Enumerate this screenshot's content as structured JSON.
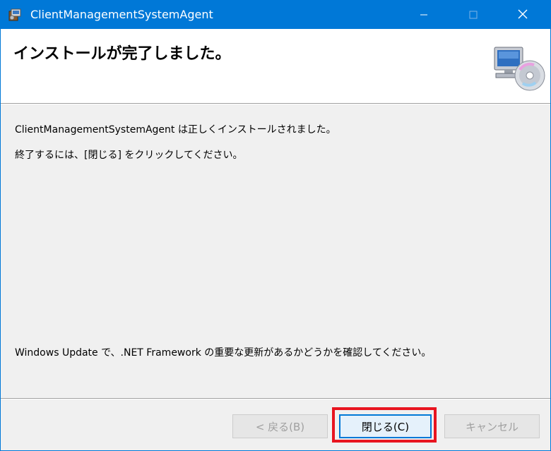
{
  "window": {
    "title": "ClientManagementSystemAgent",
    "app_icon": "installer-package-icon",
    "controls": {
      "minimize": "minimize-icon",
      "maximize": "maximize-icon",
      "close": "close-icon"
    }
  },
  "header": {
    "title": "インストールが完了しました。",
    "icon": "computer-cd-icon"
  },
  "body": {
    "message1": "ClientManagementSystemAgent は正しくインストールされました。",
    "message2": "終了するには、[閉じる] をクリックしてください。",
    "message3": "Windows Update で、.NET Framework の重要な更新があるかどうかを確認してください。"
  },
  "buttons": {
    "back": "< 戻る(B)",
    "close": "閉じる(C)",
    "cancel": "キャンセル",
    "back_enabled": false,
    "cancel_enabled": false
  },
  "colors": {
    "titlebar": "#0078d7",
    "highlight": "#e8141f",
    "dialog_bg": "#f0f0f0"
  }
}
